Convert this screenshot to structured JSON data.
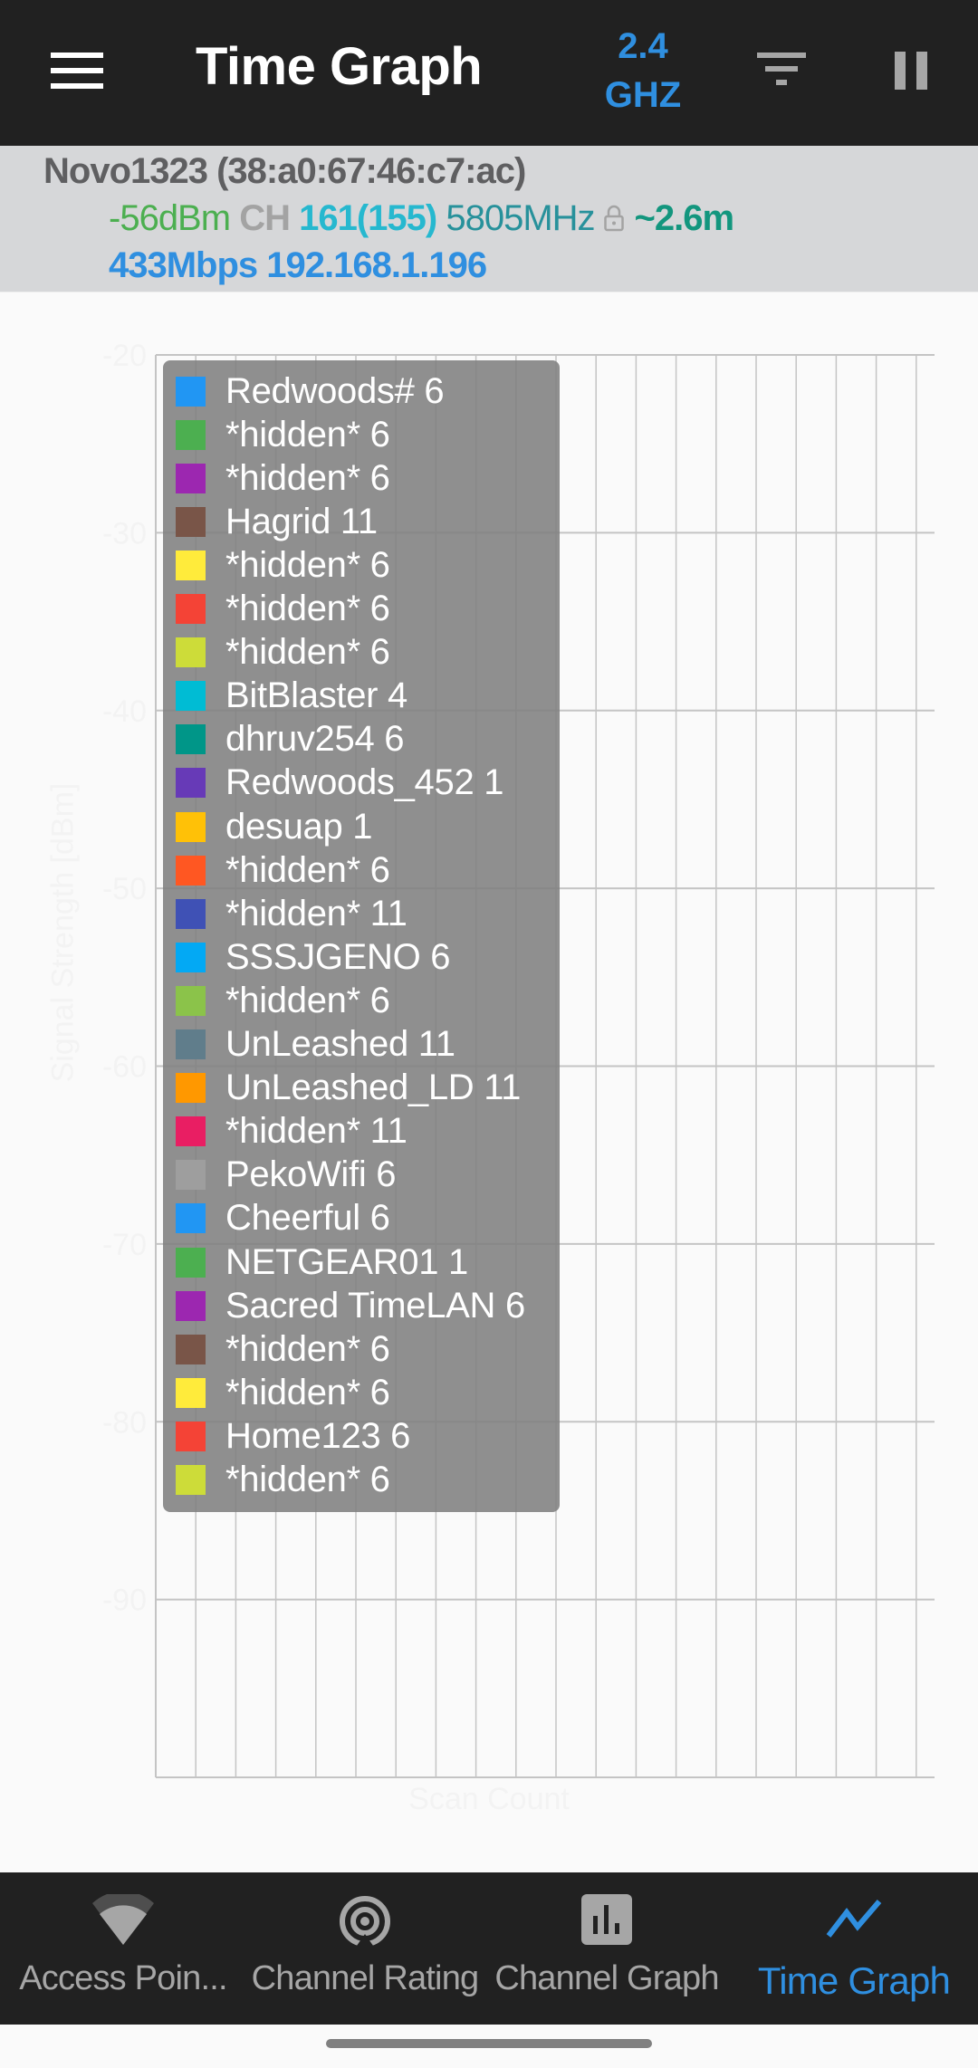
{
  "header": {
    "title": "Time Graph",
    "band_line1": "2.4",
    "band_line2": "GHZ",
    "icons": [
      "menu-icon",
      "filter-icon",
      "pause-icon"
    ]
  },
  "connection": {
    "ssid_bssid": "Novo1323 (38:a0:67:46:c7:ac)",
    "rssi": "-56dBm",
    "ch_label": "CH",
    "channel": "161(155)",
    "frequency": "5805MHz",
    "security_icon": "lock-icon",
    "distance": "~2.6m",
    "link_speed": "433Mbps",
    "ip": "192.168.1.196"
  },
  "colors": {
    "accent": "#2f8fe0",
    "header_bg": "#212121",
    "info_bg": "#d6d7d9",
    "rssi": "#4caf50",
    "channel": "#26b8cf",
    "frequency": "#27919b",
    "distance": "#13967e"
  },
  "chart_data": {
    "type": "line",
    "title": "",
    "xlabel": "Scan Count",
    "ylabel": "Signal Strength [dBm]",
    "ylim": [
      -100,
      -20
    ],
    "yticks": [
      -20,
      -30,
      -40,
      -50,
      -60,
      -70,
      -80,
      -90
    ],
    "ytick_labels": [
      "-20",
      "-30",
      "-40",
      "-50",
      "-60",
      "-70",
      "-80",
      "-90"
    ],
    "x_grid_divisions": 20,
    "grid": true,
    "legend_position": "top-left",
    "series": [
      {
        "name": "Redwoods# 6",
        "color": "#2196f3",
        "values": []
      },
      {
        "name": "*hidden* 6",
        "color": "#4caf50",
        "values": []
      },
      {
        "name": "*hidden* 6",
        "color": "#9c27b0",
        "values": []
      },
      {
        "name": "Hagrid 11",
        "color": "#795548",
        "values": []
      },
      {
        "name": "*hidden* 6",
        "color": "#ffeb3b",
        "values": []
      },
      {
        "name": "*hidden* 6",
        "color": "#f44336",
        "values": []
      },
      {
        "name": "*hidden* 6",
        "color": "#cddc39",
        "values": []
      },
      {
        "name": "BitBlaster 4",
        "color": "#00bcd4",
        "values": []
      },
      {
        "name": "dhruv254 6",
        "color": "#009688",
        "values": []
      },
      {
        "name": "Redwoods_452 1",
        "color": "#673ab7",
        "values": []
      },
      {
        "name": "desuap 1",
        "color": "#ffc107",
        "values": []
      },
      {
        "name": "*hidden* 6",
        "color": "#ff5722",
        "values": []
      },
      {
        "name": "*hidden* 11",
        "color": "#3f51b5",
        "values": []
      },
      {
        "name": "SSSJGENO 6",
        "color": "#03a9f4",
        "values": []
      },
      {
        "name": "*hidden* 6",
        "color": "#8bc34a",
        "values": []
      },
      {
        "name": "UnLeashed 11",
        "color": "#607d8b",
        "values": []
      },
      {
        "name": "UnLeashed_LD 11",
        "color": "#ff9800",
        "values": []
      },
      {
        "name": "*hidden* 11",
        "color": "#e91e63",
        "values": []
      },
      {
        "name": "PekoWifi 6",
        "color": "#9e9e9e",
        "values": []
      },
      {
        "name": "Cheerful 6",
        "color": "#2196f3",
        "values": []
      },
      {
        "name": "NETGEAR01 1",
        "color": "#4caf50",
        "values": []
      },
      {
        "name": "Sacred TimeLAN 6",
        "color": "#9c27b0",
        "values": []
      },
      {
        "name": "*hidden* 6",
        "color": "#795548",
        "values": []
      },
      {
        "name": "*hidden* 6",
        "color": "#ffeb3b",
        "values": []
      },
      {
        "name": "Home123 6",
        "color": "#f44336",
        "values": []
      },
      {
        "name": "*hidden* 6",
        "color": "#cddc39",
        "values": []
      }
    ]
  },
  "bottom_nav": {
    "items": [
      {
        "label": "Access Poin...",
        "icon": "wifi-icon",
        "active": false
      },
      {
        "label": "Channel Rating",
        "icon": "broadcast-icon",
        "active": false
      },
      {
        "label": "Channel Graph",
        "icon": "bar-chart-icon",
        "active": false
      },
      {
        "label": "Time Graph",
        "icon": "line-chart-icon",
        "active": true
      }
    ]
  }
}
